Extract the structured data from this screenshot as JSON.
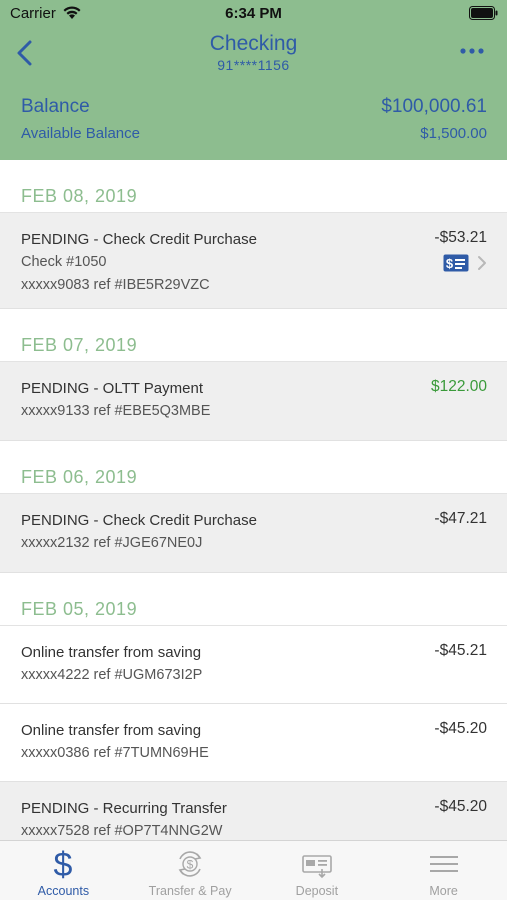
{
  "status_bar": {
    "carrier": "Carrier",
    "time": "6:34 PM"
  },
  "header": {
    "title": "Checking",
    "account_number": "91****1156",
    "balance_label": "Balance",
    "balance_value": "$100,000.61",
    "available_label": "Available Balance",
    "available_value": "$1,500.00"
  },
  "colors": {
    "header_bg": "#8dbd8f",
    "accent": "#2f5ba7",
    "credit": "#3a9a3a"
  },
  "groups": [
    {
      "date": "FEB 08, 2019",
      "transactions": [
        {
          "description": "PENDING - Check Credit Purchase",
          "detail": "Check #1050",
          "reference": "xxxxx9083 ref #IBE5R29VZC",
          "amount": "-$53.21"
        }
      ]
    },
    {
      "date": "FEB 07, 2019",
      "transactions": [
        {
          "description": "PENDING - OLTT Payment",
          "reference": "xxxxx9133 ref #EBE5Q3MBE",
          "amount": "$122.00"
        }
      ]
    },
    {
      "date": "FEB 06, 2019",
      "transactions": [
        {
          "description": "PENDING - Check Credit Purchase",
          "reference": "xxxxx2132 ref #JGE67NE0J",
          "amount": "-$47.21"
        }
      ]
    },
    {
      "date": "FEB 05, 2019",
      "transactions": [
        {
          "description": "Online transfer from saving",
          "reference": "xxxxx4222 ref #UGM673I2P",
          "amount": "-$45.21"
        },
        {
          "description": "Online transfer from saving",
          "reference": "xxxxx0386 ref #7TUMN69HE",
          "amount": "-$45.20"
        },
        {
          "description": "PENDING - Recurring Transfer",
          "reference": "xxxxx7528 ref #OP7T4NNG2W",
          "amount": "-$45.20"
        }
      ]
    }
  ],
  "tabs": [
    {
      "label": "Accounts",
      "icon": "dollar-icon",
      "active": true
    },
    {
      "label": "Transfer & Pay",
      "icon": "transfer-icon",
      "active": false
    },
    {
      "label": "Deposit",
      "icon": "deposit-check-icon",
      "active": false
    },
    {
      "label": "More",
      "icon": "menu-icon",
      "active": false
    }
  ]
}
